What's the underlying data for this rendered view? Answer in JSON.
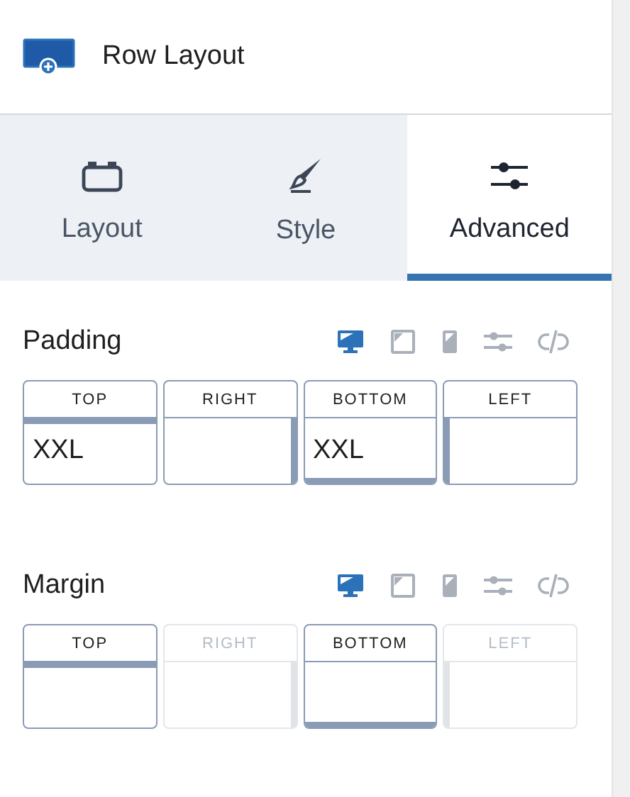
{
  "header": {
    "title": "Row Layout"
  },
  "tabs": [
    {
      "kind": "layout",
      "label": "Layout",
      "selected": false
    },
    {
      "kind": "style",
      "label": "Style",
      "selected": false
    },
    {
      "kind": "advanced",
      "label": "Advanced",
      "selected": true
    }
  ],
  "sections": [
    {
      "label": "Padding",
      "devices": [
        {
          "kind": "desktop",
          "selected": true
        },
        {
          "kind": "tablet",
          "selected": false
        },
        {
          "kind": "mobile",
          "selected": false
        }
      ],
      "fields": [
        {
          "kind": "top",
          "label": "TOP",
          "value": "XXL",
          "disabled": false
        },
        {
          "kind": "right",
          "label": "RIGHT",
          "disabled": false
        },
        {
          "kind": "bottom",
          "label": "BOTTOM",
          "value": "XXL",
          "disabled": false
        },
        {
          "kind": "left",
          "label": "LEFT",
          "disabled": false
        }
      ]
    },
    {
      "label": "Margin",
      "devices": [
        {
          "kind": "desktop",
          "selected": true
        },
        {
          "kind": "tablet",
          "selected": false
        },
        {
          "kind": "mobile",
          "selected": false
        }
      ],
      "fields": [
        {
          "kind": "top",
          "label": "TOP",
          "disabled": false
        },
        {
          "kind": "right",
          "label": "RIGHT",
          "disabled": true
        },
        {
          "kind": "bottom",
          "label": "BOTTOM",
          "disabled": false
        },
        {
          "kind": "left",
          "label": "LEFT",
          "disabled": true
        }
      ]
    }
  ]
}
